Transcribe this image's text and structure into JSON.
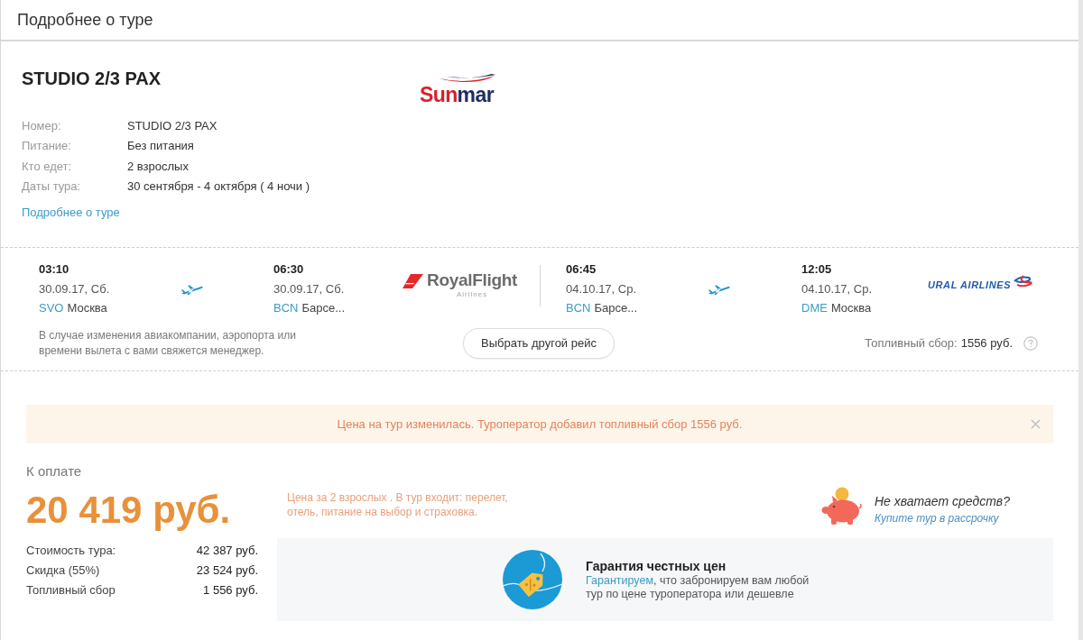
{
  "header": {
    "title": "Подробнее о туре"
  },
  "tour": {
    "title": "STUDIO 2/3 PAX",
    "operator_logo": {
      "parts": [
        "Sun",
        "mar"
      ]
    },
    "details": [
      {
        "label": "Номер:",
        "value": "STUDIO 2/3 PAX"
      },
      {
        "label": "Питание:",
        "value": "Без питания"
      },
      {
        "label": "Кто едет:",
        "value": "2 взрослых"
      },
      {
        "label": "Даты тура:",
        "value": "30 сентября - 4 октября ( 4 ночи )"
      }
    ],
    "link": "Подробнее о туре"
  },
  "flights": {
    "legs": [
      {
        "departure": {
          "time": "03:10",
          "date": "30.09.17, Сб.",
          "code": "SVO",
          "city": "Москва"
        },
        "arrival": {
          "time": "06:30",
          "date": "30.09.17, Сб.",
          "code": "BCN",
          "city": "Барсе..."
        },
        "airline": {
          "kind": "royalflight",
          "name": "RoyalFlight",
          "subtitle": "Airlines"
        }
      },
      {
        "departure": {
          "time": "06:45",
          "date": "04.10.17, Ср.",
          "code": "BCN",
          "city": "Барсе..."
        },
        "arrival": {
          "time": "12:05",
          "date": "04.10.17, Ср.",
          "code": "DME",
          "city": "Москва"
        },
        "airline": {
          "kind": "ural",
          "name": "URAL AIRLINES"
        }
      }
    ],
    "note": "В случае изменения авиакомпании, аэропорта или времени вылета с вами свяжется менеджер.",
    "change_button": "Выбрать другой рейс",
    "fuel_fee": {
      "label": "Топливный сбор:",
      "value": "1556 руб."
    }
  },
  "alert": {
    "text": "Цена на тур изменилась. Туроператор добавил топливный сбор 1556 руб."
  },
  "payment": {
    "label": "К оплате",
    "total": "20 419 руб.",
    "breakdown": [
      {
        "label": "Стоимость тура:",
        "value": "42 387 руб."
      },
      {
        "label": "Скидка (55%)",
        "value": "23 524 руб."
      },
      {
        "label": "Топливный сбор",
        "value": "1 556 руб."
      }
    ],
    "note": "Цена за 2 взрослых . В тур входит: перелет, отель, питание на выбор и страховка.",
    "installment": {
      "question": "Не хватает средств?",
      "link": "Купите тур в рассрочку"
    },
    "guarantee": {
      "title": "Гарантия честных цен",
      "link": "Гарантируем",
      "text": ", что забронируем вам любой тур по цене туроператора или дешевле"
    }
  }
}
